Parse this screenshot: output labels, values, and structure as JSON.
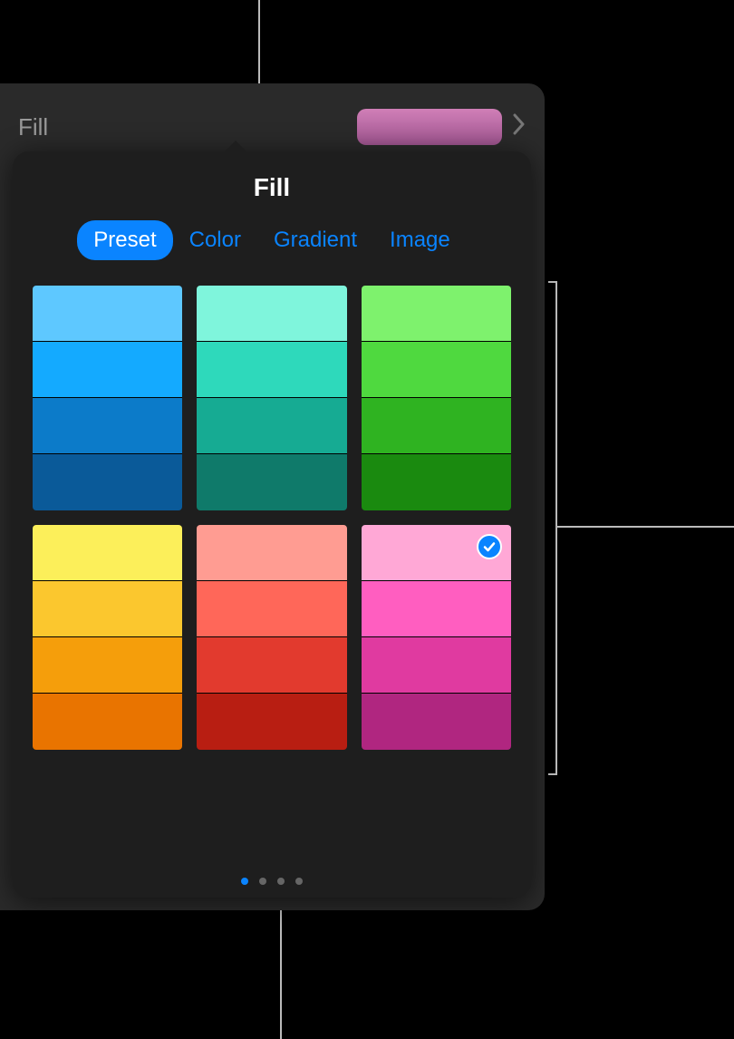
{
  "header": {
    "fill_label": "Fill",
    "swatch_color": "#b56aa0"
  },
  "popover": {
    "title": "Fill",
    "tabs": [
      {
        "label": "Preset",
        "active": true
      },
      {
        "label": "Color",
        "active": false
      },
      {
        "label": "Gradient",
        "active": false
      },
      {
        "label": "Image",
        "active": false
      }
    ],
    "swatch_groups": [
      {
        "name": "blue",
        "colors": [
          "#5ec8ff",
          "#14aaff",
          "#0c7bc9",
          "#0a5a99"
        ],
        "selected": -1
      },
      {
        "name": "teal",
        "colors": [
          "#7ff5dc",
          "#2ed9bb",
          "#16ab93",
          "#0f7a6a"
        ],
        "selected": -1
      },
      {
        "name": "green",
        "colors": [
          "#7ef26d",
          "#4fd93f",
          "#2fb321",
          "#1a8a0f"
        ],
        "selected": -1
      },
      {
        "name": "yellow",
        "colors": [
          "#fcef5a",
          "#fbc72e",
          "#f59e0b",
          "#e97400"
        ],
        "selected": -1
      },
      {
        "name": "red",
        "colors": [
          "#ff9c92",
          "#ff6759",
          "#e23a2e",
          "#b81e12"
        ],
        "selected": -1
      },
      {
        "name": "pink",
        "colors": [
          "#ffa8d6",
          "#ff5ec0",
          "#e03aa0",
          "#b02680"
        ],
        "selected": 0
      }
    ],
    "page_indicator": {
      "count": 4,
      "active": 0
    }
  }
}
